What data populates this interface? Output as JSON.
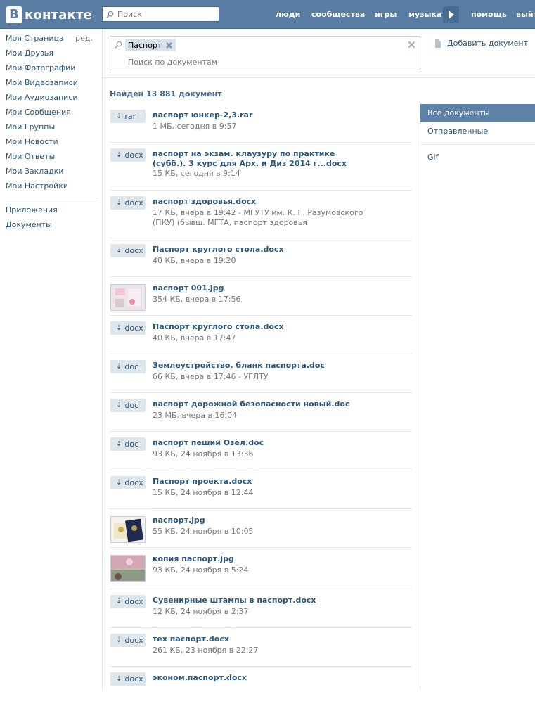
{
  "header": {
    "logo_letter": "В",
    "logo_text": "контакте",
    "search_placeholder": "Поиск",
    "nav": [
      "люди",
      "сообщества",
      "игры",
      "музыка",
      "помощь",
      "выйти"
    ]
  },
  "left_menu": {
    "edit_label": "ред.",
    "items": [
      "Моя Страница",
      "Мои Друзья",
      "Мои Фотографии",
      "Мои Видеозаписи",
      "Мои Аудиозаписи",
      "Мои Сообщения",
      "Мои Группы",
      "Мои Новости",
      "Мои Ответы",
      "Мои Закладки",
      "Мои Настройки"
    ],
    "extra_items": [
      "Приложения",
      "Документы"
    ]
  },
  "search": {
    "tag": "Паспорт",
    "placeholder": "Поиск по документам"
  },
  "add_document": "Добавить документ",
  "found_text": "Найден 13 881 документ",
  "filters": {
    "items": [
      "Все документы",
      "Отправленные"
    ],
    "extra": [
      "Gif"
    ]
  },
  "documents": [
    {
      "ext": "rar",
      "title": "паспорт юнкер-2,3.rar",
      "meta": "1 МБ, сегодня в 9:57"
    },
    {
      "ext": "docx",
      "title": "паспорт на экзам. клаузуру по практике (субб.). 3 курс для Арх. и Диз 2014 г...docx",
      "meta": "15 КБ, сегодня в 9:14"
    },
    {
      "ext": "docx",
      "title": "паспорт здоровья.docx",
      "meta": "17 КБ, вчера в 19:42 - МГУТУ им. К. Г. Разумовского (ПКУ) (бывш. МГТА, паспорт здоровья"
    },
    {
      "ext": "docx",
      "title": "Паспорт круглого стола.docx",
      "meta": "40 КБ, вчера в 19:20"
    },
    {
      "ext": "",
      "thumb": "pink",
      "title": "паспорт 001.jpg",
      "meta": "354 КБ, вчера в 17:56"
    },
    {
      "ext": "docx",
      "title": "Паспорт круглого стола.docx",
      "meta": "40 КБ, вчера в 17:47"
    },
    {
      "ext": "doc",
      "title": "Землеустройство. бланк паспорта.doc",
      "meta": "66 КБ, вчера в 17:46 - УГЛТУ"
    },
    {
      "ext": "doc",
      "title": "паспорт дорожной безопасности новый.doc",
      "meta": "23 МБ, вчера в 16:04"
    },
    {
      "ext": "doc",
      "title": "паспорт пеший Озёл.doc",
      "meta": "93 КБ, 24 ноября в 13:36"
    },
    {
      "ext": "docx",
      "title": "Паспорт проекта.docx",
      "meta": "15 КБ, 24 ноября в 12:44"
    },
    {
      "ext": "",
      "thumb": "passport",
      "title": "паспорт.jpg",
      "meta": "55 КБ, 24 ноября в 10:05"
    },
    {
      "ext": "",
      "thumb": "copy",
      "title": "копия паспорт.jpg",
      "meta": "93 КБ, 24 ноября в 5:24"
    },
    {
      "ext": "docx",
      "title": "Сувенирные штампы в паспорт.docx",
      "meta": "12 КБ, 24 ноября в 2:37"
    },
    {
      "ext": "docx",
      "title": "тех паспорт.docx",
      "meta": "261 КБ, 23 ноября в 22:27"
    },
    {
      "ext": "docx",
      "title": "эконом.паспорт.docx",
      "meta": ""
    }
  ],
  "colors": {
    "header_bg": "#597da3",
    "link": "#2b587a",
    "active_filter": "#5e81a8"
  }
}
